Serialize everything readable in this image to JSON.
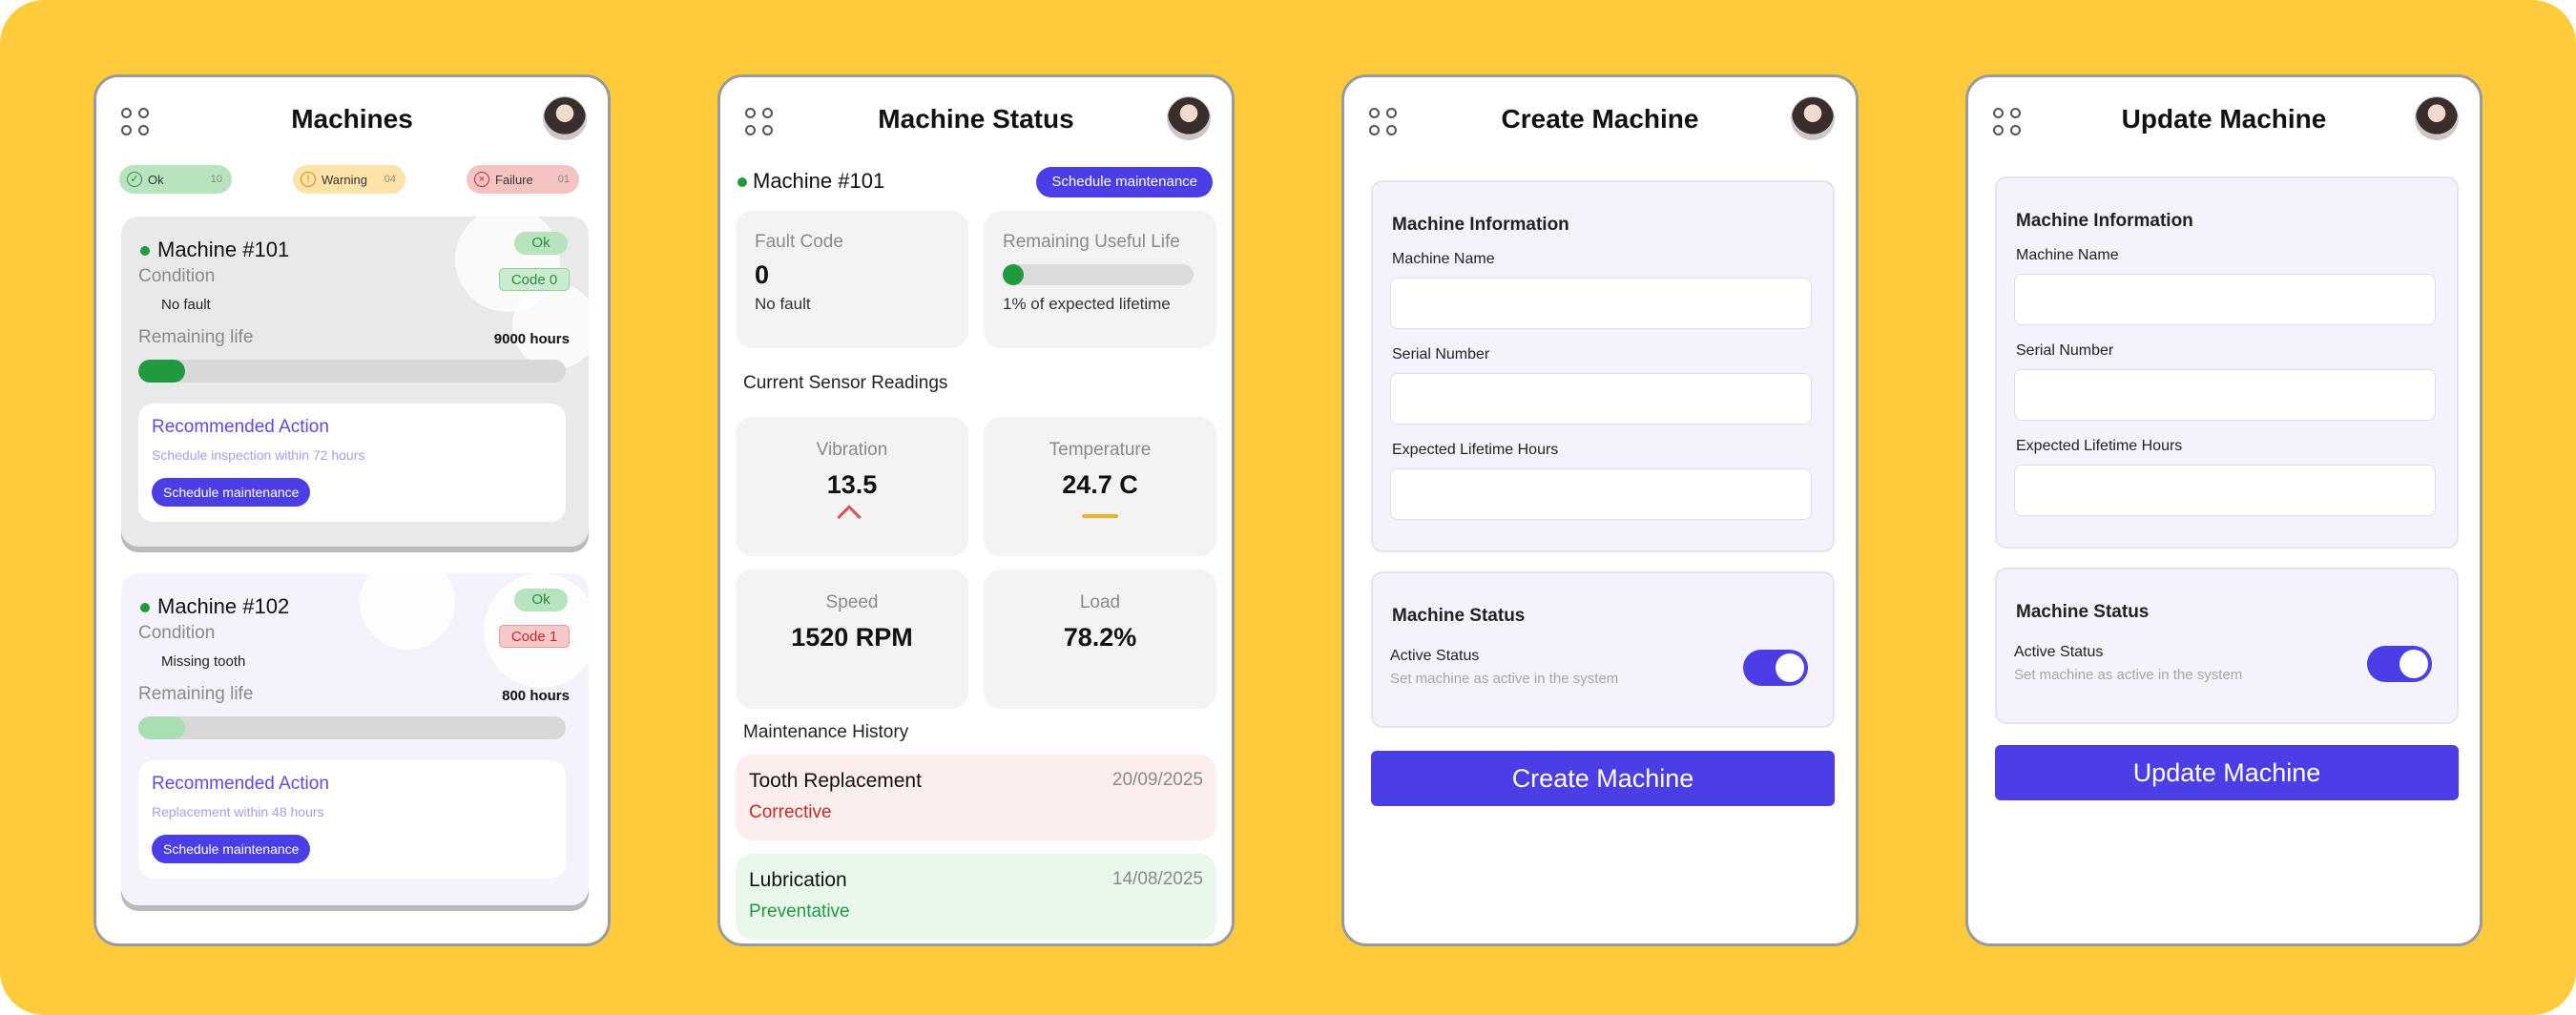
{
  "screens": {
    "machines": {
      "title": "Machines",
      "pills": [
        {
          "label": "Ok",
          "count": "10"
        },
        {
          "label": "Warning",
          "count": "04"
        },
        {
          "label": "Failure",
          "count": "01"
        }
      ],
      "cards": [
        {
          "name": "Machine #101",
          "badge": "Ok",
          "code": "Code 0",
          "condition_label": "Condition",
          "condition": "No fault",
          "life_label": "Remaining life",
          "hours": "9000 hours",
          "life_fraction": 0.11,
          "rec_title": "Recommended Action",
          "rec_sub": "Schedule inspection within 72 hours",
          "button": "Schedule maintenance"
        },
        {
          "name": "Machine #102",
          "badge": "Ok",
          "code": "Code 1",
          "condition_label": "Condition",
          "condition": "Missing tooth",
          "life_label": "Remaining life",
          "hours": "800 hours",
          "life_fraction": 0.11,
          "rec_title": "Recommended Action",
          "rec_sub": "Replacement within 48 hours",
          "button": "Schedule maintenance"
        }
      ]
    },
    "status": {
      "title": "Machine Status",
      "machine": "Machine #101",
      "schedule_button": "Schedule maintenance",
      "fault": {
        "label": "Fault Code",
        "value": "0",
        "desc": "No fault"
      },
      "rul": {
        "label": "Remaining Useful Life",
        "desc": "1% of expected lifetime",
        "fraction": 0.01
      },
      "sensors_label": "Current Sensor Readings",
      "sensors": [
        {
          "label": "Vibration",
          "value": "13.5"
        },
        {
          "label": "Temperature",
          "value": "24.7 C"
        },
        {
          "label": "Speed",
          "value": "1520 RPM"
        },
        {
          "label": "Load",
          "value": "78.2%"
        }
      ],
      "history_label": "Maintenance History",
      "history": [
        {
          "title": "Tooth Replacement",
          "date": "20/09/2025",
          "type": "Corrective"
        },
        {
          "title": "Lubrication",
          "date": "14/08/2025",
          "type": "Preventative"
        }
      ]
    },
    "create": {
      "title": "Create Machine",
      "info_title": "Machine Information",
      "name_label": "Machine Name",
      "serial_label": "Serial Number",
      "lifetime_label": "Expected Lifetime Hours",
      "status_title": "Machine Status",
      "active_label": "Active Status",
      "active_sub": "Set machine as active in the system",
      "button": "Create Machine"
    },
    "update": {
      "title": "Update Machine",
      "info_title": "Machine Information",
      "name_label": "Machine Name",
      "serial_label": "Serial Number",
      "lifetime_label": "Expected Lifetime Hours",
      "status_title": "Machine Status",
      "active_label": "Active Status",
      "active_sub": "Set machine as active in the system",
      "button": "Update Machine"
    }
  },
  "icons": {
    "menu": "grid-menu-icon",
    "avatar": "user-avatar",
    "ok": "check-circle-icon",
    "warning": "exclamation-circle-icon",
    "failure": "x-circle-icon",
    "trend_up": "chevron-up-icon",
    "trend_flat": "dash-icon"
  },
  "colors": {
    "background": "#FFCB3D",
    "accent": "#4B3EE6",
    "ok": "#1F9A3E",
    "warning": "#F0AD2B",
    "failure": "#C62828"
  }
}
